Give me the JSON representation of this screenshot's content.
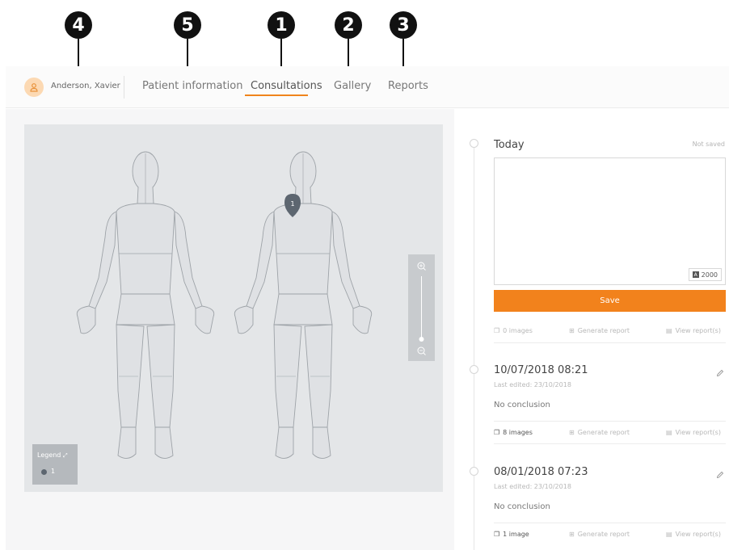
{
  "callouts": [
    "4",
    "5",
    "1",
    "2",
    "3"
  ],
  "nav": {
    "patient_name": "Anderson, Xavier",
    "tabs": [
      "Patient information",
      "Consultations",
      "Gallery",
      "Reports"
    ],
    "active_tab": "Consultations"
  },
  "body_map": {
    "marker": "1",
    "legend": {
      "title": "Legend",
      "item": "1"
    }
  },
  "consultations": [
    {
      "title": "Today",
      "status": "Not saved",
      "counter": "2000",
      "counter_badge": "A",
      "save_label": "Save",
      "images": "0 images",
      "generate": "Generate report",
      "view": "View report(s)"
    },
    {
      "title": "10/07/2018 08:21",
      "last_edited": "Last edited: 23/10/2018",
      "conclusion": "No conclusion",
      "images": "8 images",
      "generate": "Generate report",
      "view": "View report(s)"
    },
    {
      "title": "08/01/2018 07:23",
      "last_edited": "Last edited: 23/10/2018",
      "conclusion": "No conclusion",
      "images": "1 image",
      "generate": "Generate report",
      "view": "View report(s)"
    }
  ],
  "colors": {
    "accent": "#f2821c",
    "avatar_bg": "#fcd9b3",
    "map_bg": "#e4e6e8",
    "marker": "#5d6670"
  }
}
